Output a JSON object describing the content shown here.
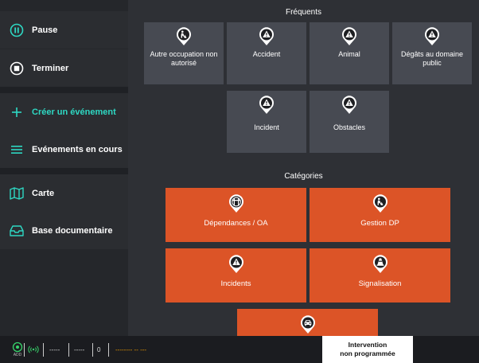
{
  "sidebar": {
    "items": [
      {
        "label": "Pause",
        "icon": "pause-circle-icon"
      },
      {
        "label": "Terminer",
        "icon": "stop-circle-icon"
      },
      {
        "label": "Créer un événement",
        "icon": "plus-icon"
      },
      {
        "label": "Evénements en cours",
        "icon": "list-icon"
      },
      {
        "label": "Carte",
        "icon": "map-icon"
      },
      {
        "label": "Base documentaire",
        "icon": "inbox-tray-icon"
      }
    ],
    "accent_color": "#2ed8c3"
  },
  "main": {
    "frequents_title": "Fréquents",
    "frequents": [
      {
        "label": "Autre occupation non autorisé",
        "icon": "roadwork-pin-icon"
      },
      {
        "label": "Accident",
        "icon": "warning-pin-icon"
      },
      {
        "label": "Animal",
        "icon": "warning-pin-icon"
      },
      {
        "label": "Dégâts au domaine public",
        "icon": "warning-pin-icon"
      },
      {
        "label": "Incident",
        "icon": "warning-pin-icon"
      },
      {
        "label": "Obstacles",
        "icon": "warning-pin-icon"
      }
    ],
    "categories_title": "Catégories",
    "categories": [
      {
        "label": "Dépendances / OA",
        "icon": "crossing-pin-icon"
      },
      {
        "label": "Gestion DP",
        "icon": "roadwork-pin-icon"
      },
      {
        "label": "Incidents",
        "icon": "warning-pin-icon"
      },
      {
        "label": "Signalisation",
        "icon": "cone-pin-icon"
      },
      {
        "label": "",
        "icon": "car-pin-icon"
      }
    ],
    "tile_color": "#474a52",
    "category_color": "#dc5427"
  },
  "statusbar": {
    "gps_label": "ADD",
    "field1": "-----",
    "field2": "-----",
    "count": "0",
    "time": "-------- -- ---",
    "time_color": "#f2a000"
  },
  "intervention": {
    "line1": "Intervention",
    "line2": "non programmée"
  }
}
